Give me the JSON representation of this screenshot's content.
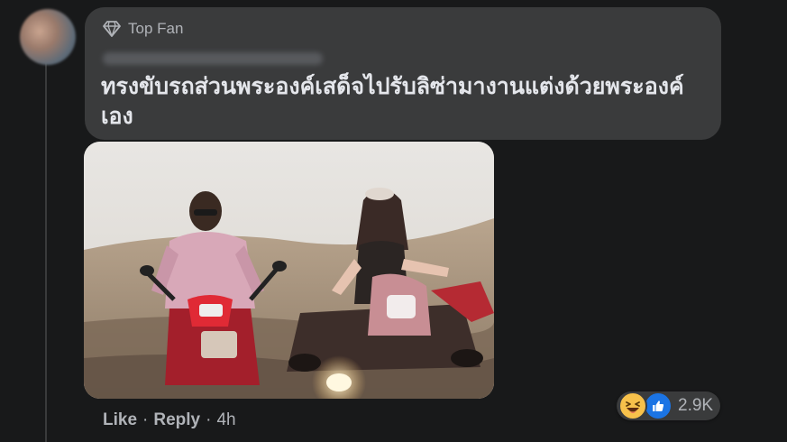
{
  "comment": {
    "badge_label": "Top Fan",
    "text": "ทรงขับรถส่วนพระองค์เสด็จไปรับลิซ่ามางานแต่งด้วยพระองค์เอง"
  },
  "actions": {
    "like_label": "Like",
    "reply_label": "Reply",
    "separator": "·",
    "time": "4h"
  },
  "reactions": {
    "icons": [
      "haha-icon",
      "like-icon"
    ],
    "count": "2.9K"
  },
  "colors": {
    "background": "#18191a",
    "bubble": "#3a3b3c",
    "text_primary": "#e4e6eb",
    "text_secondary": "#b0b3b8",
    "like_blue": "#1b74e4",
    "haha_yellow": "#f7c14b"
  }
}
